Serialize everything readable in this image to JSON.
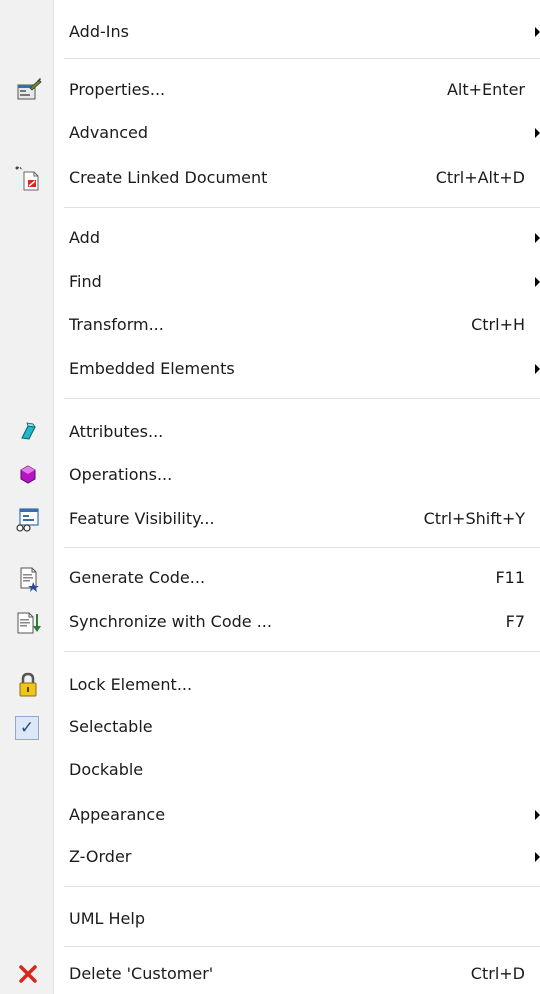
{
  "menu": {
    "items": [
      {
        "label": "Add-Ins",
        "shortcut": "",
        "submenu": true,
        "icon": ""
      },
      {
        "label": "Properties...",
        "shortcut": "Alt+Enter",
        "submenu": false,
        "icon": "properties-icon"
      },
      {
        "label": "Advanced",
        "shortcut": "",
        "submenu": true,
        "icon": ""
      },
      {
        "label": "Create Linked Document",
        "shortcut": "Ctrl+Alt+D",
        "submenu": false,
        "icon": "linked-document-icon"
      },
      {
        "label": "Add",
        "shortcut": "",
        "submenu": true,
        "icon": ""
      },
      {
        "label": "Find",
        "shortcut": "",
        "submenu": true,
        "icon": ""
      },
      {
        "label": "Transform...",
        "shortcut": "Ctrl+H",
        "submenu": false,
        "icon": ""
      },
      {
        "label": "Embedded Elements",
        "shortcut": "",
        "submenu": true,
        "icon": ""
      },
      {
        "label": "Attributes...",
        "shortcut": "",
        "submenu": false,
        "icon": "attributes-icon"
      },
      {
        "label": "Operations...",
        "shortcut": "",
        "submenu": false,
        "icon": "operations-icon"
      },
      {
        "label": "Feature Visibility...",
        "shortcut": "Ctrl+Shift+Y",
        "submenu": false,
        "icon": "feature-visibility-icon"
      },
      {
        "label": "Generate Code...",
        "shortcut": "F11",
        "submenu": false,
        "icon": "generate-code-icon"
      },
      {
        "label": "Synchronize with Code ...",
        "shortcut": "F7",
        "submenu": false,
        "icon": "synchronize-code-icon"
      },
      {
        "label": "Lock Element...",
        "shortcut": "",
        "submenu": false,
        "icon": "lock-icon"
      },
      {
        "label": "Selectable",
        "shortcut": "",
        "submenu": false,
        "icon": "checkmark-icon",
        "checked": true
      },
      {
        "label": "Dockable",
        "shortcut": "",
        "submenu": false,
        "icon": ""
      },
      {
        "label": "Appearance",
        "shortcut": "",
        "submenu": true,
        "icon": ""
      },
      {
        "label": "Z-Order",
        "shortcut": "",
        "submenu": true,
        "icon": ""
      },
      {
        "label": "UML Help",
        "shortcut": "",
        "submenu": false,
        "icon": ""
      },
      {
        "label": "Delete 'Customer'",
        "shortcut": "Ctrl+D",
        "submenu": false,
        "icon": "delete-icon"
      }
    ],
    "check_glyph": "✓"
  },
  "colors": {
    "gutter": "#f1f1f1",
    "text": "#1b1b1b",
    "separator": "#e0e0e0",
    "delete_red": "#d9261c"
  }
}
